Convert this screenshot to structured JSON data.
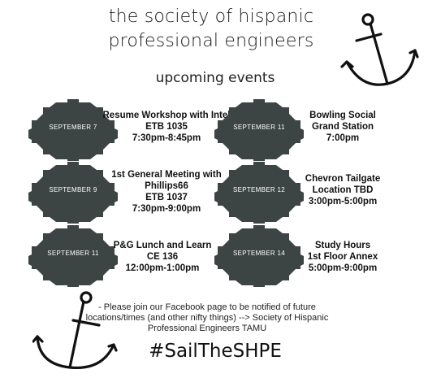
{
  "header": {
    "title_line1": "the society of hispanic",
    "title_line2": "professional engineers",
    "subtitle": "upcoming events"
  },
  "colors": {
    "gear": "#3d4444",
    "text": "#111111"
  },
  "events_left": [
    {
      "date": "SEPTEMBER 7",
      "lines": [
        "Resume Workshop with Intel",
        "ETB 1035",
        "7:30pm-8:45pm"
      ]
    },
    {
      "date": "SEPTEMBER 9",
      "lines": [
        "1st General Meeting with",
        "Phillips66",
        "ETB 1037",
        "7:30pm-9:00pm"
      ]
    },
    {
      "date": "SEPTEMBER 11",
      "lines": [
        "P&G Lunch and Learn",
        "CE 136",
        "12:00pm-1:00pm"
      ]
    }
  ],
  "events_right": [
    {
      "date": "SEPTEMBER 11",
      "lines": [
        "Bowling Social",
        "Grand Station",
        "7:00pm"
      ]
    },
    {
      "date": "SEPTEMBER 12",
      "lines": [
        "Chevron Tailgate",
        "Location TBD",
        "3:00pm-5:00pm"
      ]
    },
    {
      "date": "SEPTEMBER 14",
      "lines": [
        "Study Hours",
        "1st Floor Annex",
        "5:00pm-9:00pm"
      ]
    }
  ],
  "footer": {
    "note_line1": "- Please join our Facebook page to be notified of future",
    "note_line2": "locations/times (and other nifty things) --> Society of Hispanic",
    "note_line3": "Professional Engineers TAMU",
    "hashtag": "#SailTheSHPE"
  },
  "icons": {
    "top_right": "anchor-icon",
    "bottom_left": "anchor-icon",
    "event_badge": "gear-icon"
  }
}
